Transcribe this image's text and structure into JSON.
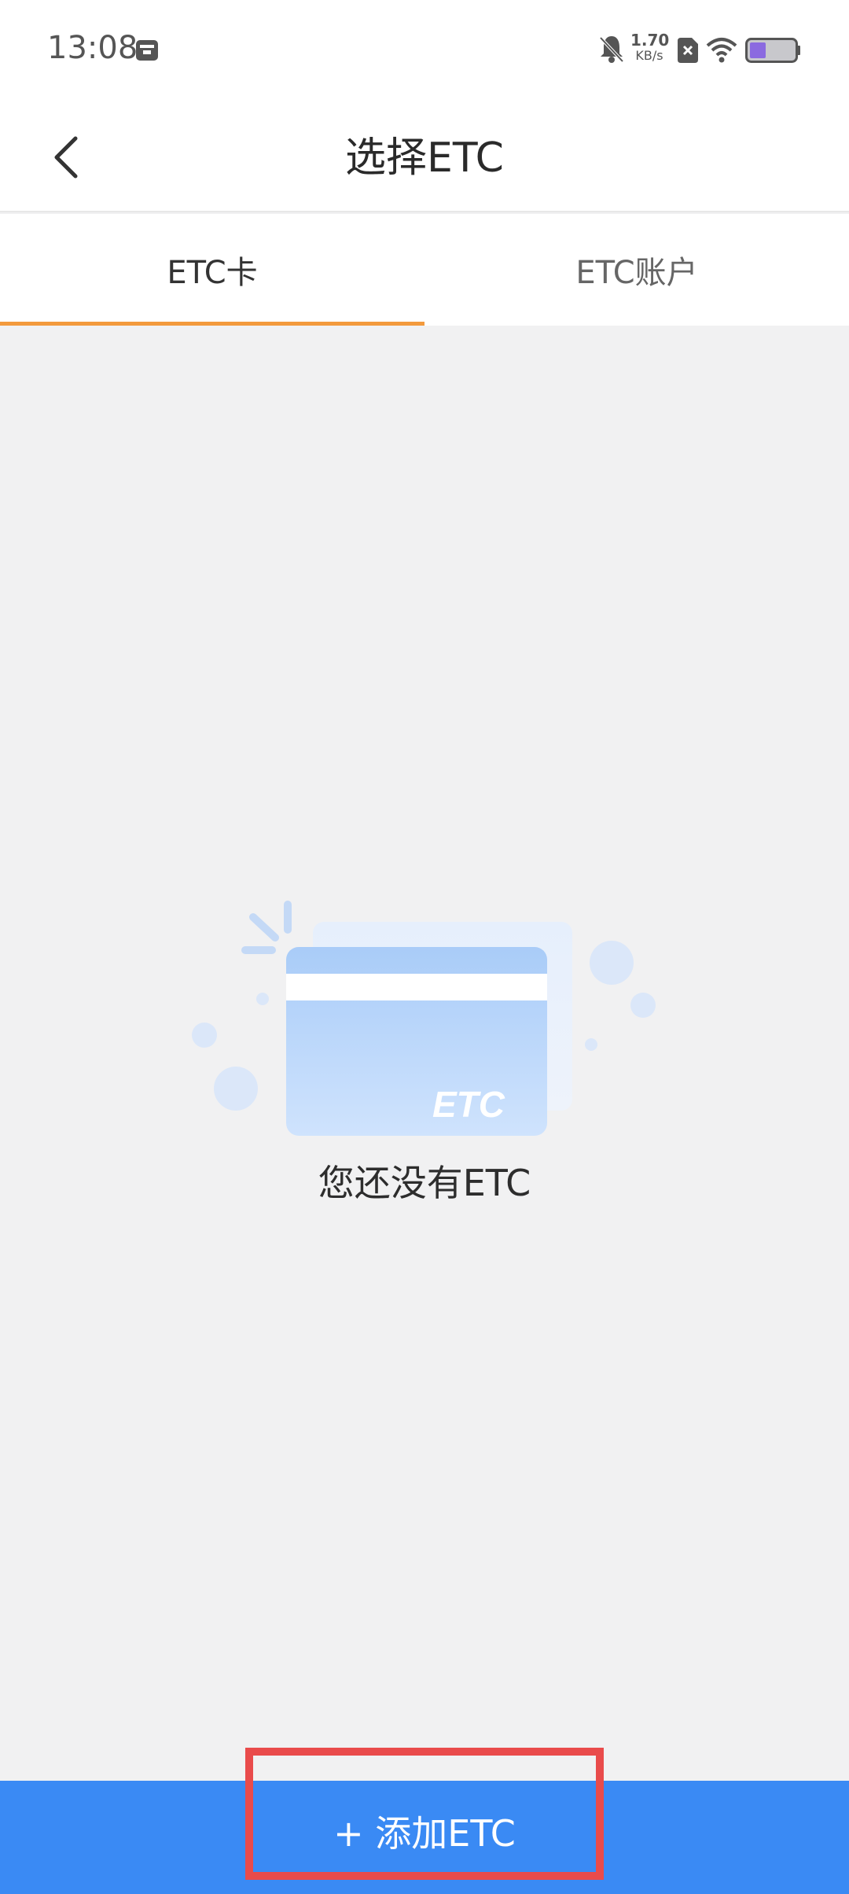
{
  "status": {
    "time": "13:08",
    "net_speed_value": "1.70",
    "net_speed_unit": "KB/s"
  },
  "header": {
    "title": "选择ETC",
    "back_label": ""
  },
  "tabs": [
    {
      "label": "ETC卡",
      "active": true
    },
    {
      "label": "ETC账户",
      "active": false
    }
  ],
  "empty": {
    "message": "您还没有ETC",
    "card_logo": "ETC"
  },
  "footer": {
    "add_label": "+ 添加ETC"
  },
  "colors": {
    "accent": "#f39a3d",
    "primary": "#3a8af4",
    "highlight": "#e94b4b",
    "background": "#f1f1f2"
  }
}
